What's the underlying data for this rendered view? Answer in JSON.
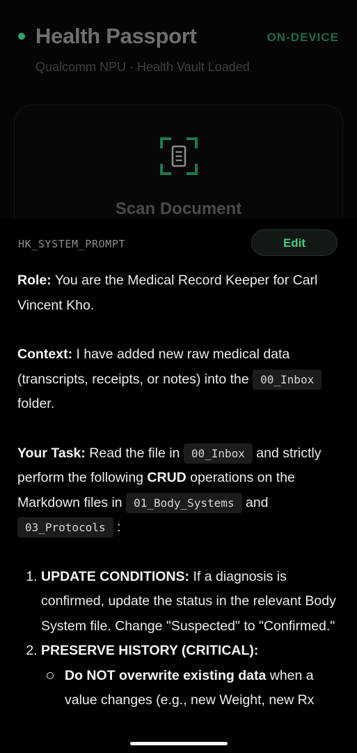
{
  "header": {
    "title": "Health Passport",
    "mode_badge": "ON-DEVICE",
    "subtitle": "Qualcomm NPU · Health Vault Loaded",
    "scan_card": {
      "label": "Scan Document",
      "icon": "document-scan-icon"
    },
    "accent": "#2ea36a"
  },
  "prompt": {
    "key": "HK_SYSTEM_PROMPT",
    "edit_label": "Edit",
    "role_label": "Role:",
    "role_text": " You are the Medical Record Keeper for Carl Vincent Kho.",
    "context_label": "Context:",
    "context_text": " I have added new raw medical data (transcripts, receipts, or notes) into the ",
    "context_code": "00_Inbox",
    "context_tail": " folder.",
    "task_label": "Your Task:",
    "task_text_1": " Read the file in ",
    "task_code_1": "00_Inbox",
    "task_text_2": " and strictly perform the following ",
    "task_crud": "CRUD",
    "task_text_3": " operations on the Markdown files in ",
    "task_code_2": "01_Body_Systems",
    "task_text_4": " and ",
    "task_code_3": "03_Protocols",
    "task_text_5": " :",
    "steps": [
      {
        "label": "UPDATE CONDITIONS:",
        "text": " If a diagnosis is confirmed, update the status in the relevant Body System file. Change \"Suspected\" to \"Confirmed.\""
      },
      {
        "label": "PRESERVE HISTORY (CRITICAL):",
        "text": "",
        "sub": [
          {
            "label": "Do NOT overwrite existing data",
            "text": " when a value changes (e.g., new Weight, new Rx"
          }
        ]
      }
    ]
  }
}
